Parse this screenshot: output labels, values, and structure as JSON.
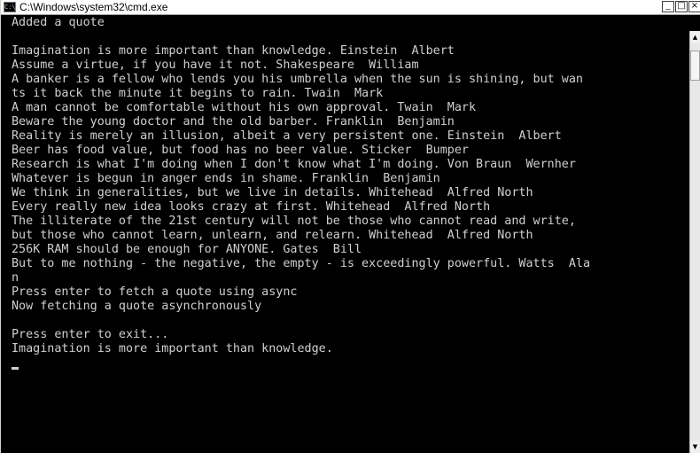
{
  "window": {
    "title": "C:\\Windows\\system32\\cmd.exe",
    "icon": "cmd-icon",
    "controls": {
      "minimize": "_",
      "maximize": "□",
      "close": "×"
    }
  },
  "console": {
    "lines": [
      "Added a quote",
      "",
      "Imagination is more important than knowledge. Einstein  Albert",
      "Assume a virtue, if you have it not. Shakespeare  William",
      "A banker is a fellow who lends you his umbrella when the sun is shining, but wan",
      "ts it back the minute it begins to rain. Twain  Mark",
      "A man cannot be comfortable without his own approval. Twain  Mark",
      "Beware the young doctor and the old barber. Franklin  Benjamin",
      "Reality is merely an illusion, albeit a very persistent one. Einstein  Albert",
      "Beer has food value, but food has no beer value. Sticker  Bumper",
      "Research is what I'm doing when I don't know what I'm doing. Von Braun  Wernher",
      "Whatever is begun in anger ends in shame. Franklin  Benjamin",
      "We think in generalities, but we live in details. Whitehead  Alfred North",
      "Every really new idea looks crazy at first. Whitehead  Alfred North",
      "The illiterate of the 21st century will not be those who cannot read and write,",
      "but those who cannot learn, unlearn, and relearn. Whitehead  Alfred North",
      "256K RAM should be enough for ANYONE. Gates  Bill",
      "But to me nothing - the negative, the empty - is exceedingly powerful. Watts  Ala",
      "n",
      "Press enter to fetch a quote using async",
      "Now fetching a quote asynchronously",
      "",
      "Press enter to exit...",
      "Imagination is more important than knowledge.",
      ""
    ]
  },
  "scrollbar": {
    "up_arrow": "▲",
    "down_arrow": "▼"
  },
  "colors": {
    "background": "#000000",
    "text": "#d0d0d0",
    "titlebar": "#ffffff"
  }
}
